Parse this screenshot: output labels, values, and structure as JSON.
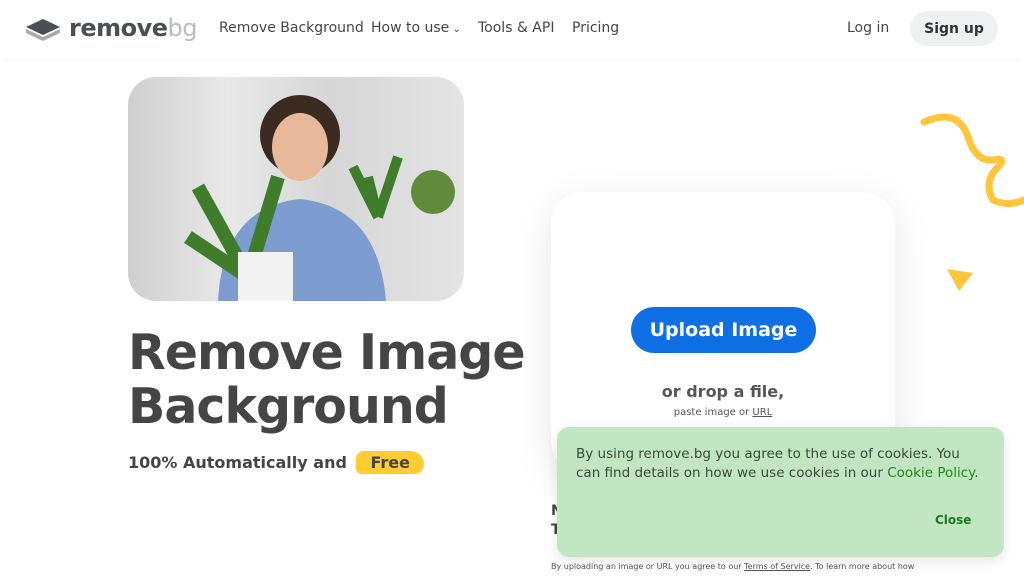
{
  "nav": {
    "logo_main": "remove",
    "logo_suffix": "bg",
    "items": [
      "Remove Background",
      "How to use",
      "Tools & API",
      "Pricing"
    ],
    "login": "Log in",
    "signup": "Sign up"
  },
  "hero": {
    "title_line1": "Remove Image",
    "title_line2": "Background",
    "subtitle": "100% Automatically and",
    "badge": "Free"
  },
  "upload": {
    "button": "Upload Image",
    "drop": "or drop a file,",
    "paste_prefix": "paste image or",
    "paste_link": "URL"
  },
  "partial": {
    "line1": "N",
    "line2": "T"
  },
  "terms": {
    "prefix": "By uploading an image or URL you agree to our",
    "link": "Terms of Service",
    "suffix": ". To learn more about how"
  },
  "cookie": {
    "text": "By using remove.bg you agree to the use of cookies. You can find details on how we use cookies in our",
    "link": "Cookie Policy",
    "end": ".",
    "close": "Close"
  },
  "colors": {
    "primary": "#0f70e6",
    "badge": "#ffcc33",
    "cookie_bg": "#c2e6c2",
    "decor": "#ffc53d"
  }
}
